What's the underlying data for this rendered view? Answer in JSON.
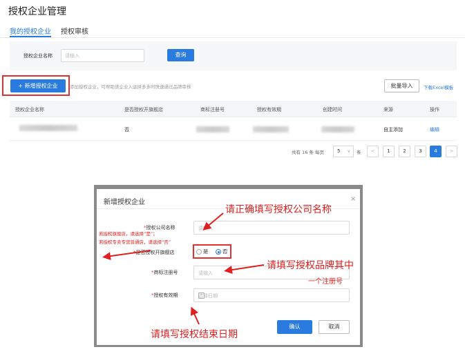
{
  "page": {
    "title": "授权企业管理"
  },
  "tabs": [
    {
      "label": "我的授权企业",
      "active": true
    },
    {
      "label": "授权审核",
      "active": false
    }
  ],
  "filter": {
    "label": "授权企业名称",
    "placeholder": "请输入",
    "query_label": "查询"
  },
  "toolbar": {
    "add_label": "+ 新增授权企业",
    "hint": "添加授权企业，可帮助该企业入驻拼多多时快速通过品牌审核",
    "batch_import_label": "批量导入",
    "download_label": "下载Excel模板"
  },
  "table": {
    "headers": [
      "授权企业名称",
      "是否授权开旗舰店",
      "商标注册号",
      "授权有效期",
      "创建时间",
      "来源",
      "操作"
    ],
    "rows": [
      {
        "flagship": "否",
        "source": "自主添加",
        "action": "编辑"
      }
    ]
  },
  "pagination": {
    "total_text": "共有 16 条  每页",
    "page_size": "5",
    "unit": "条",
    "prev": "<",
    "next": ">",
    "pages": [
      "1",
      "2",
      "3",
      "4"
    ],
    "current": "4"
  },
  "modal": {
    "title": "新增授权企业",
    "close": "×",
    "fields": {
      "company_label": "授权公司名称",
      "company_placeholder": "请输入",
      "flagship_label": "是否授权开旗舰店",
      "yes": "是",
      "no": "否",
      "trademark_label": "商标注册号",
      "trademark_placeholder": "请输入",
      "validity_label": "授权有效期",
      "validity_placeholder": "选择日期"
    },
    "confirm_label": "确认",
    "cancel_label": "取消"
  },
  "annotations": {
    "company": "请正确填写授权公司名称",
    "flagship_line1": "若授权旗舰店，请选择“是”；",
    "flagship_line2": "若授权专卖专营普通店，请选择“否”",
    "trademark_line1": "请填写授权品牌其中",
    "trademark_line2": "一个注册号",
    "validity": "请填写授权结束日期"
  },
  "colors": {
    "accent": "#2a7be0",
    "annotation": "#e02020"
  }
}
